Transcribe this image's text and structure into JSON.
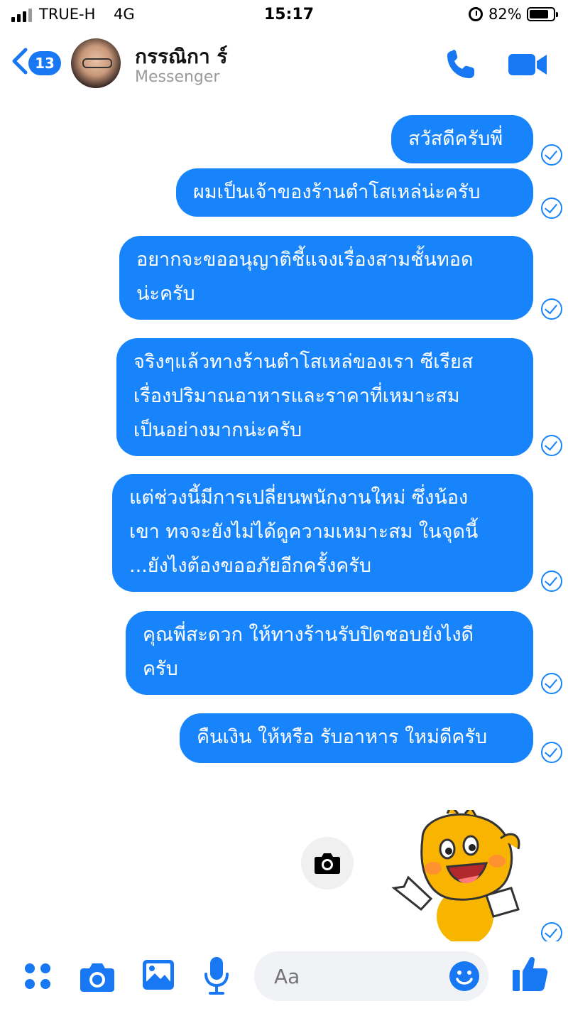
{
  "status_bar": {
    "carrier": "TRUE-H",
    "network": "4G",
    "time": "15:17",
    "battery_percent": "82%",
    "battery_level": 0.82
  },
  "header": {
    "back_badge_count": "13",
    "contact_name": "กรรณิกา ร์",
    "contact_subtitle": "Messenger",
    "icons": [
      "back-chevron-icon",
      "call-icon",
      "video-call-icon"
    ]
  },
  "messages": [
    {
      "text": "สวัสดีครับพี่",
      "status": "delivered"
    },
    {
      "text": "ผมเป็นเจ้าของร้านตำโสเหล่น่ะครับ",
      "status": "delivered"
    },
    {
      "lines": [
        "อยากจะขออนุญาติชี้แจงเรื่องสามชั้นทอด",
        "น่ะครับ"
      ],
      "status": "delivered"
    },
    {
      "lines": [
        "จริงๆแล้วทางร้านตำโสเหล่ของเรา ซีเรียส",
        "เรื่องปริมาณอาหารและราคาที่เหมาะสม",
        "เป็นอย่างมากน่ะครับ"
      ],
      "status": "delivered"
    },
    {
      "lines": [
        "แต่ช่วงนี้มีการเปลี่ยนพนักงานใหม่ ซึ่งน้อง",
        "เขา ทจจะยังไม่ได้ดูความเหมาะสม ในจุดนี้",
        "...ยังไงต้องขออภัยอีกครั้งครับ"
      ],
      "status": "delivered"
    },
    {
      "lines": [
        "คุณพี่สะดวก ให้ทางร้านรับปิดชอบยังไงดี",
        "ครับ"
      ],
      "status": "delivered"
    },
    {
      "text": "คืนเงิน ให้หรือ รับอาหาร ใหม่ดีครับ",
      "status": "delivered"
    }
  ],
  "sticker": {
    "description_icon": "yellow-mascot-sticker",
    "status": "delivered"
  },
  "composer": {
    "placeholder": "Aa",
    "icons": [
      "menu-dots-icon",
      "camera-icon",
      "gallery-icon",
      "microphone-icon",
      "emoji-icon",
      "thumbs-up-icon"
    ]
  },
  "colors": {
    "bubble": "#1784fb",
    "accent": "#1877f2"
  }
}
